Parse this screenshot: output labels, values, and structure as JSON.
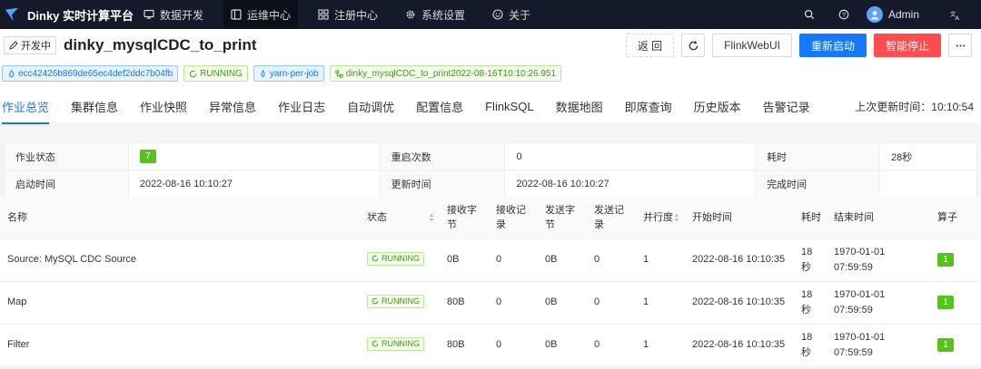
{
  "nav": {
    "brand": "Dinky 实时计算平台",
    "items": [
      {
        "label": "数据开发",
        "icon": "monitor-icon"
      },
      {
        "label": "运维中心",
        "icon": "ops-center-icon"
      },
      {
        "label": "注册中心",
        "icon": "app-grid-icon"
      },
      {
        "label": "系统设置",
        "icon": "gear-icon"
      },
      {
        "label": "关于",
        "icon": "smile-icon"
      }
    ],
    "user": "Admin"
  },
  "header": {
    "status_tag": "开发中",
    "job_name": "dinky_mysqlCDC_to_print",
    "back_label": "返 回",
    "flinkwebui_label": "FlinkWebUI",
    "restart_label": "重新启动",
    "stop_label": "智能停止"
  },
  "tags": {
    "job_id": "ecc42426b869de65ec4def2ddc7b04fb",
    "status": "RUNNING",
    "mode": "yarn-per-job",
    "instance": "dinky_mysqlCDC_to_print2022-08-16T10:10:26.951"
  },
  "tabs": [
    "作业总览",
    "集群信息",
    "作业快照",
    "异常信息",
    "作业日志",
    "自动调优",
    "配置信息",
    "FlinkSQL",
    "数据地图",
    "即席查询",
    "历史版本",
    "告警记录"
  ],
  "update_time": "上次更新时间：10:10:54",
  "info": {
    "job_status_label": "作业状态",
    "job_status_value": "7",
    "restart_count_label": "重启次数",
    "restart_count_value": "0",
    "duration_label": "耗时",
    "duration_value": "28秒",
    "start_time_label": "启动时间",
    "start_time_value": "2022-08-16 10:10:27",
    "update_time_label": "更新时间",
    "update_time_value": "2022-08-16 10:10:27",
    "finish_time_label": "完成时间",
    "finish_time_value": ""
  },
  "operators": {
    "headers": [
      "名称",
      "状态",
      "接收字节",
      "接收记录",
      "发送字节",
      "发送记录",
      "并行度",
      "开始时间",
      "耗时",
      "结束时间",
      "算子"
    ],
    "rows": [
      {
        "name": "Source: MySQL CDC Source",
        "status": "RUNNING",
        "recv_bytes": "0B",
        "recv_records": "0",
        "send_bytes": "0B",
        "send_records": "0",
        "parallelism": "1",
        "start_time": "2022-08-16 10:10:35",
        "duration": "18秒",
        "end_time": "1970-01-01 07:59:59",
        "op": "1"
      },
      {
        "name": "Map",
        "status": "RUNNING",
        "recv_bytes": "80B",
        "recv_records": "0",
        "send_bytes": "0B",
        "send_records": "0",
        "parallelism": "1",
        "start_time": "2022-08-16 10:10:35",
        "duration": "18秒",
        "end_time": "1970-01-01 07:59:59",
        "op": "1"
      },
      {
        "name": "Filter",
        "status": "RUNNING",
        "recv_bytes": "80B",
        "recv_records": "0",
        "send_bytes": "0B",
        "send_records": "0",
        "parallelism": "1",
        "start_time": "2022-08-16 10:10:35",
        "duration": "18秒",
        "end_time": "1970-01-01 07:59:59",
        "op": "1"
      }
    ]
  },
  "colors": {
    "nav_bg": "#141a29",
    "primary": "#1677ff",
    "danger": "#ff4d4f",
    "success": "#52c41a"
  }
}
